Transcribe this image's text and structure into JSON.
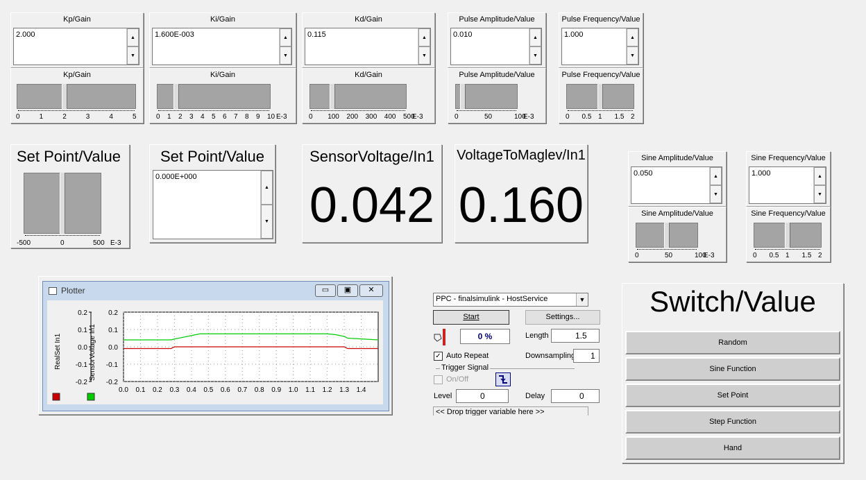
{
  "gain_panels": [
    {
      "title": "Kp/Gain",
      "value": "2.000",
      "slider_title": "Kp/Gain",
      "ticks": [
        "0",
        "1",
        "2",
        "3",
        "4",
        "5"
      ],
      "unit": ""
    },
    {
      "title": "Ki/Gain",
      "value": "1.600E-003",
      "slider_title": "Ki/Gain",
      "ticks": [
        "0",
        "1",
        "2",
        "3",
        "4",
        "5",
        "6",
        "7",
        "8",
        "9",
        "10"
      ],
      "unit": "E-3"
    },
    {
      "title": "Kd/Gain",
      "value": "0.115",
      "slider_title": "Kd/Gain",
      "ticks": [
        "0",
        "100",
        "200",
        "300",
        "400",
        "500"
      ],
      "unit": "E-3"
    },
    {
      "title": "Pulse Amplitude/Value",
      "value": "0.010",
      "slider_title": "Pulse Amplitude/Value",
      "ticks": [
        "0",
        "50",
        "100"
      ],
      "unit": "E-3"
    },
    {
      "title": "Pulse Frequency/Value",
      "value": "1.000",
      "slider_title": "Pulse Frequency/Value",
      "ticks": [
        "0",
        "0.5",
        "1",
        "1.5",
        "2"
      ],
      "unit": ""
    }
  ],
  "setpoint_slider": {
    "title": "Set Point/Value",
    "ticks": [
      "-500",
      "0",
      "500"
    ],
    "unit": "E-3"
  },
  "setpoint_edit": {
    "title": "Set Point/Value",
    "value": "0.000E+000"
  },
  "sensor_display": {
    "title": "SensorVoltage/In1",
    "value": "0.042"
  },
  "maglev_display": {
    "title": "VoltageToMaglev/In1",
    "value": "0.160"
  },
  "sine_panels": [
    {
      "title": "Sine Amplitude/Value",
      "value": "0.050",
      "slider_title": "Sine Amplitude/Value",
      "ticks": [
        "0",
        "50",
        "100"
      ],
      "unit": "E-3"
    },
    {
      "title": "Sine Frequency/Value",
      "value": "1.000",
      "slider_title": "Sine Frequency/Value",
      "ticks": [
        "0",
        "0.5",
        "1",
        "1.5",
        "2"
      ],
      "unit": ""
    }
  ],
  "plotter": {
    "window_title": "Plotter",
    "ylabel1": "RealSet In1",
    "ylabel2": "SensorVoltage In1",
    "yticks1": [
      "0.2",
      "0.1",
      "0.0",
      "-0.1",
      "-0.2"
    ],
    "yticks2": [
      "0.2",
      "0.1",
      "0.0",
      "-0.1",
      "-0.2"
    ],
    "xticks": [
      "0.0",
      "0.1",
      "0.2",
      "0.3",
      "0.4",
      "0.5",
      "0.6",
      "0.7",
      "0.8",
      "0.9",
      "1.0",
      "1.1",
      "1.2",
      "1.3",
      "1.4"
    ],
    "colors": {
      "realset": "#cc0000",
      "sensor": "#00cc00",
      "background": "#ffffff"
    }
  },
  "chart_data": {
    "type": "line",
    "x": [
      0.0,
      0.28,
      0.3,
      0.45,
      0.6,
      0.8,
      1.0,
      1.2,
      1.25,
      1.3,
      1.32,
      1.5
    ],
    "series": [
      {
        "name": "RealSet In1",
        "values": [
          -0.01,
          -0.01,
          0.0,
          0.0,
          0.0,
          0.0,
          0.0,
          0.0,
          0.0,
          0.0,
          -0.01,
          -0.01
        ]
      },
      {
        "name": "SensorVoltage In1",
        "values": [
          0.04,
          0.04,
          0.045,
          0.075,
          0.075,
          0.075,
          0.075,
          0.075,
          0.07,
          0.06,
          0.05,
          0.04
        ]
      }
    ],
    "xlim": [
      0,
      1.5
    ],
    "ylim": [
      -0.2,
      0.2
    ]
  },
  "host_service": {
    "target_select": "PPC - finalsimulink - HostService",
    "start_label": "Start",
    "settings_label": "Settings...",
    "progress_text": "0 %",
    "length_label": "Length",
    "length_value": "1.5",
    "auto_repeat_label": "Auto Repeat",
    "auto_repeat_checked": true,
    "downsampling_label": "Downsampling",
    "downsampling_value": "1",
    "trigger_signal_label": "Trigger Signal",
    "onoff_label": "On/Off",
    "level_label": "Level",
    "level_value": "0",
    "delay_label": "Delay",
    "delay_value": "0",
    "drop_trigger_text": "<< Drop trigger variable here >>"
  },
  "switch_panel": {
    "title": "Switch/Value",
    "buttons": [
      "Random",
      "Sine Function",
      "Set Point",
      "Step Function",
      "Hand"
    ]
  }
}
